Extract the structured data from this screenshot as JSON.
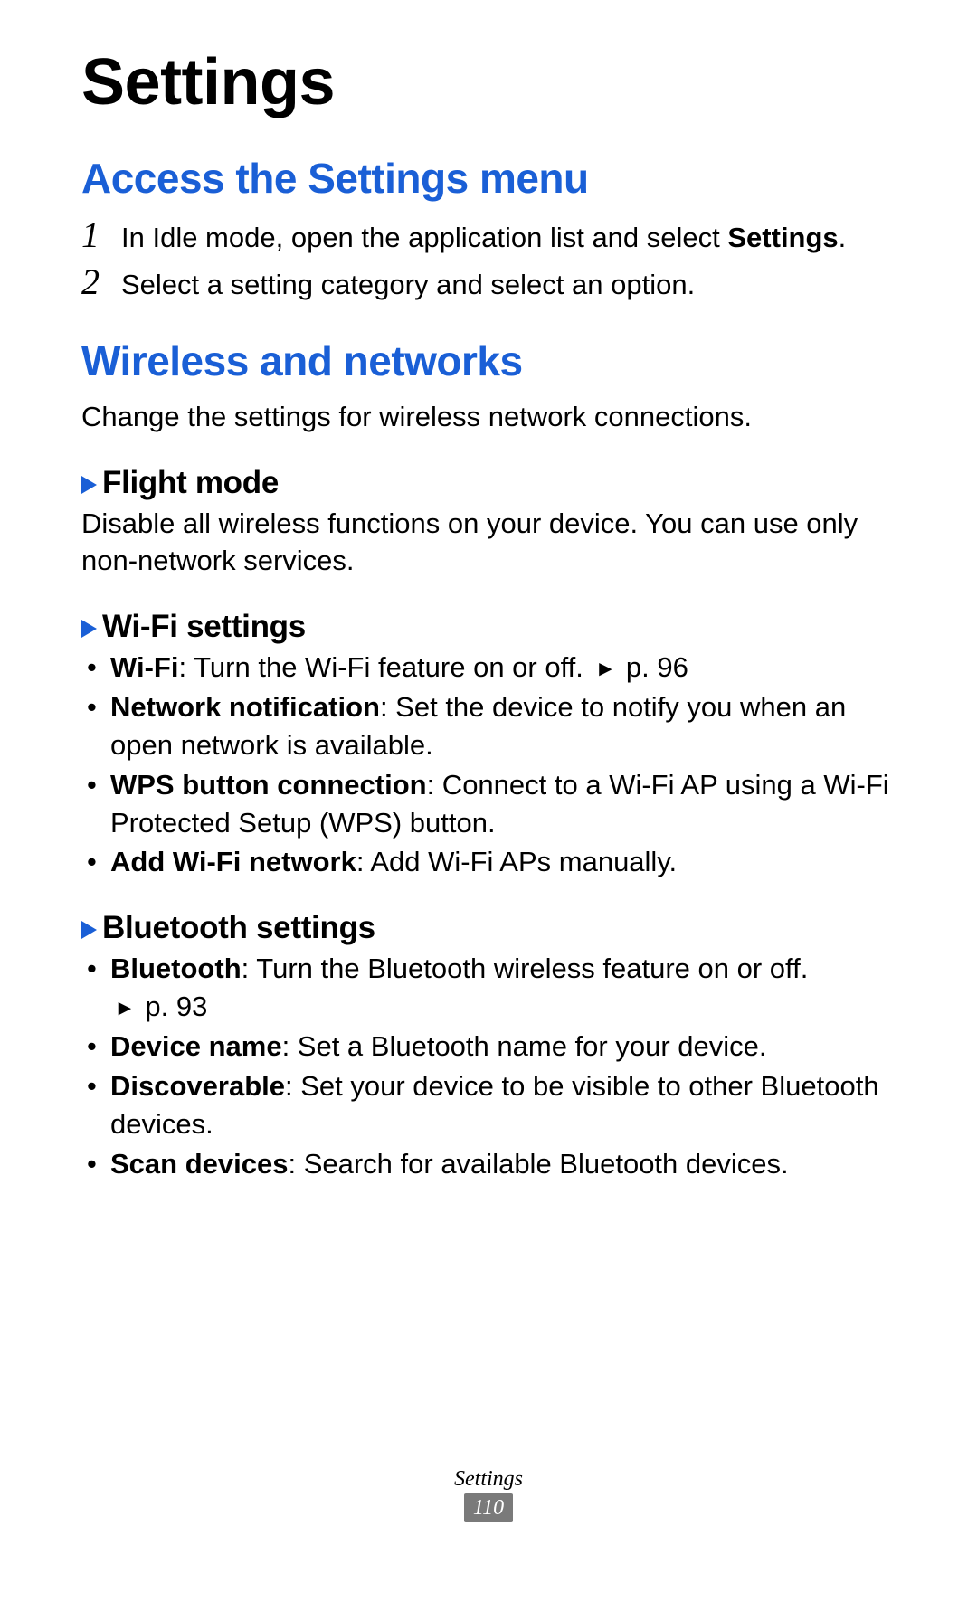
{
  "title": "Settings",
  "sections": {
    "access": {
      "heading": "Access the Settings menu",
      "steps": [
        {
          "num": "1",
          "pre": "In Idle mode, open the application list and select ",
          "bold": "Settings",
          "post": "."
        },
        {
          "num": "2",
          "text": "Select a setting category and select an option."
        }
      ]
    },
    "wireless": {
      "heading": "Wireless and networks",
      "intro": "Change the settings for wireless network connections.",
      "subsections": {
        "flight": {
          "heading": "Flight mode",
          "text": "Disable all wireless functions on your device. You can use only non-network services."
        },
        "wifi": {
          "heading": "Wi-Fi settings",
          "items": [
            {
              "bold": "Wi-Fi",
              "text": ": Turn the Wi-Fi feature on or off. ",
              "ref": "p. 96"
            },
            {
              "bold": "Network notification",
              "text": ": Set the device to notify you when an open network is available."
            },
            {
              "bold": "WPS button connection",
              "text": ": Connect to a Wi-Fi AP using a Wi-Fi Protected Setup (WPS) button."
            },
            {
              "bold": "Add Wi-Fi network",
              "text": ": Add Wi-Fi APs manually."
            }
          ]
        },
        "bluetooth": {
          "heading": "Bluetooth settings",
          "items": [
            {
              "bold": "Bluetooth",
              "text": ": Turn the Bluetooth wireless feature on or off. ",
              "refline": "p. 93"
            },
            {
              "bold": "Device name",
              "text": ": Set a Bluetooth name for your device."
            },
            {
              "bold": "Discoverable",
              "text": ": Set your device to be visible to other Bluetooth devices."
            },
            {
              "bold": "Scan devices",
              "text": ": Search for available Bluetooth devices."
            }
          ]
        }
      }
    }
  },
  "footer": {
    "label": "Settings",
    "page": "110"
  }
}
